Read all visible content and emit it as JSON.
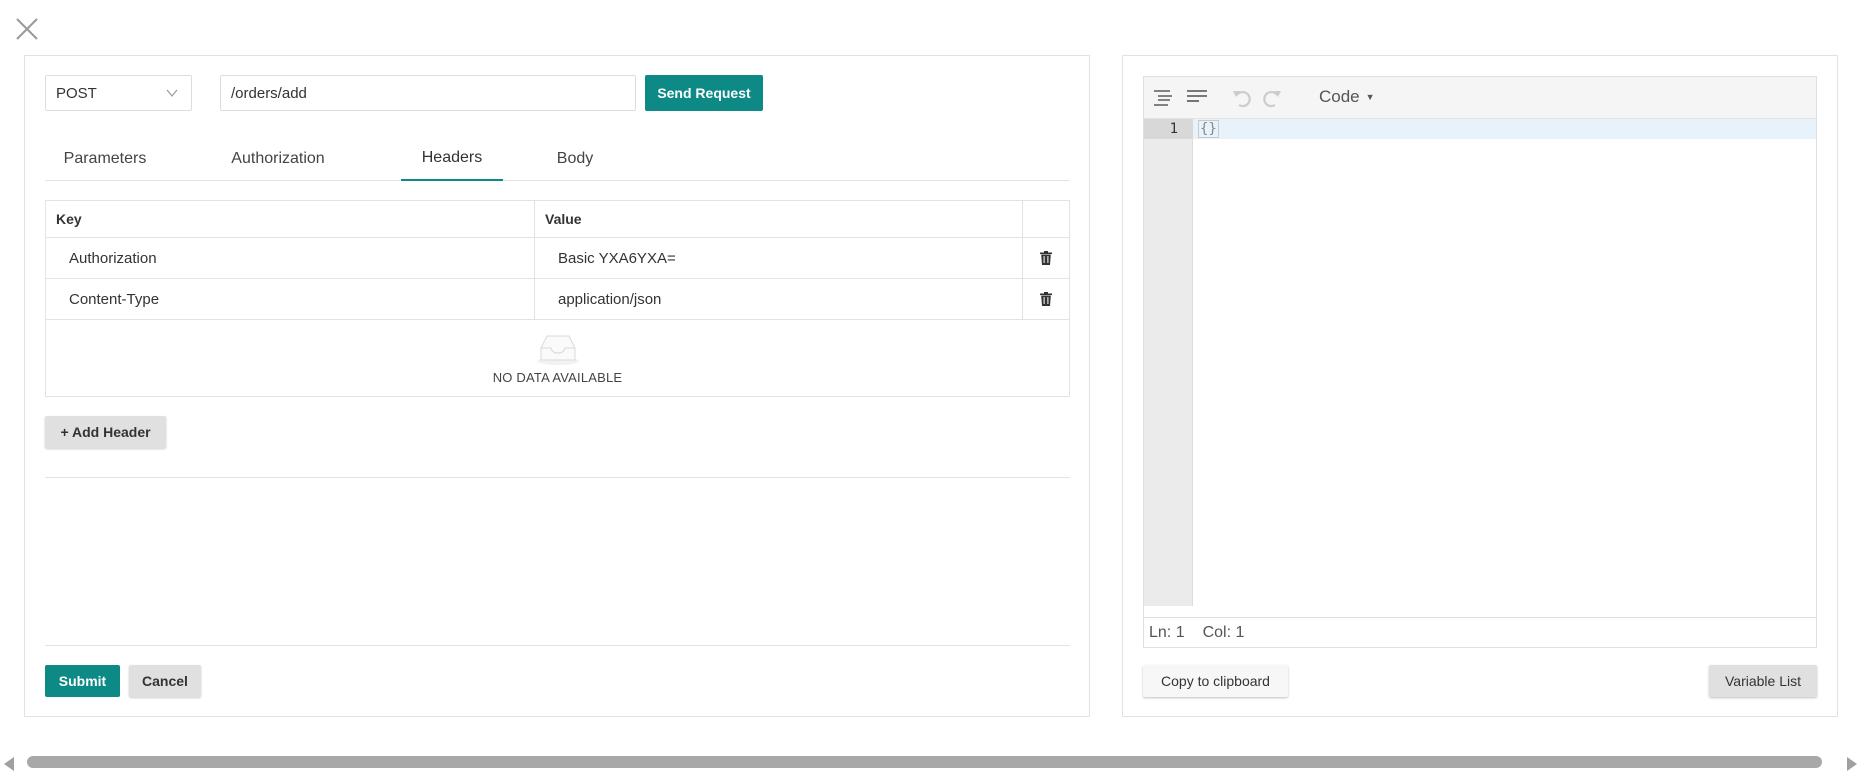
{
  "icons": {
    "close": "close-icon",
    "chevron": "chevron-down-icon",
    "trash": "trash-icon",
    "empty": "empty-inbox-icon",
    "format": "format-icon",
    "compact": "compact-icon",
    "undo": "undo-icon",
    "redo": "redo-icon"
  },
  "colors": {
    "accent": "#0e8a86",
    "secondary_button": "#e0e0e0"
  },
  "request": {
    "method": "POST",
    "url": "/orders/add",
    "send_label": "Send Request"
  },
  "tabs": [
    {
      "label": "Parameters",
      "active": false
    },
    {
      "label": "Authorization",
      "active": false
    },
    {
      "label": "Headers",
      "active": true
    },
    {
      "label": "Body",
      "active": false
    }
  ],
  "headers_table": {
    "columns": [
      "Key",
      "Value"
    ],
    "rows": [
      {
        "key": "Authorization",
        "value": "Basic YXA6YXA="
      },
      {
        "key": "Content-Type",
        "value": "application/json"
      }
    ],
    "empty_text": "NO DATA AVAILABLE"
  },
  "add_header_label": "+ Add Header",
  "footer": {
    "submit_label": "Submit",
    "cancel_label": "Cancel"
  },
  "editor": {
    "mode_label": "Code",
    "line_number": "1",
    "content": "{}",
    "status_ln": "Ln: 1",
    "status_col": "Col: 1",
    "copy_label": "Copy to clipboard",
    "variable_list_label": "Variable List"
  }
}
